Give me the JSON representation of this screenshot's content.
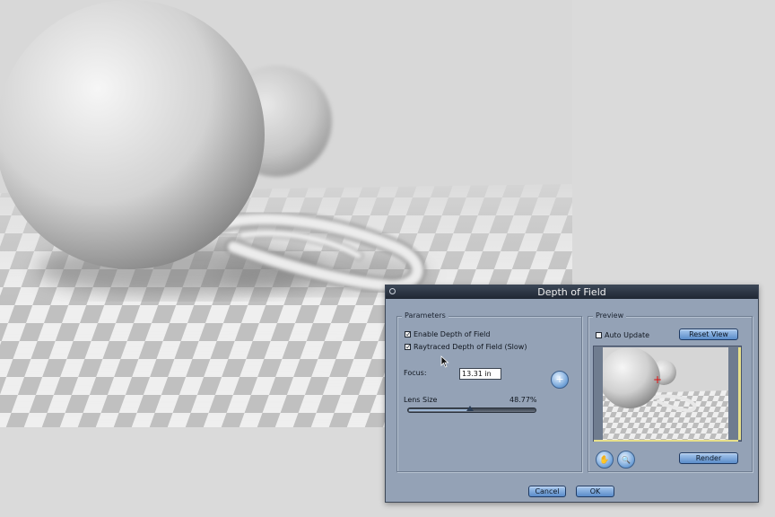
{
  "dialog": {
    "title": "Depth of Field"
  },
  "parameters": {
    "group_label": "Parameters",
    "enable_dof": {
      "label": "Enable Depth of Field",
      "checked": true
    },
    "raytraced_dof": {
      "label": "Raytraced Depth of Field (Slow)",
      "checked": true
    },
    "focus": {
      "label": "Focus:",
      "value": "13.31 in"
    },
    "lens_size": {
      "label": "Lens Size",
      "value_text": "48.77%",
      "fraction": 0.4877
    }
  },
  "preview": {
    "group_label": "Preview",
    "auto_update": {
      "label": "Auto Update",
      "checked": false
    },
    "reset_view_label": "Reset View",
    "render_label": "Render"
  },
  "footer": {
    "cancel_label": "Cancel",
    "ok_label": "OK"
  },
  "icons": {
    "checkmark": "✓",
    "crosshair": "+",
    "hand": "✋",
    "zoom": "🔍"
  },
  "colors": {
    "dialog_bg": "#94a2b6",
    "titlebar": "#2a3441",
    "button": "#6f9fd8",
    "focus_marker": "#e01010"
  }
}
